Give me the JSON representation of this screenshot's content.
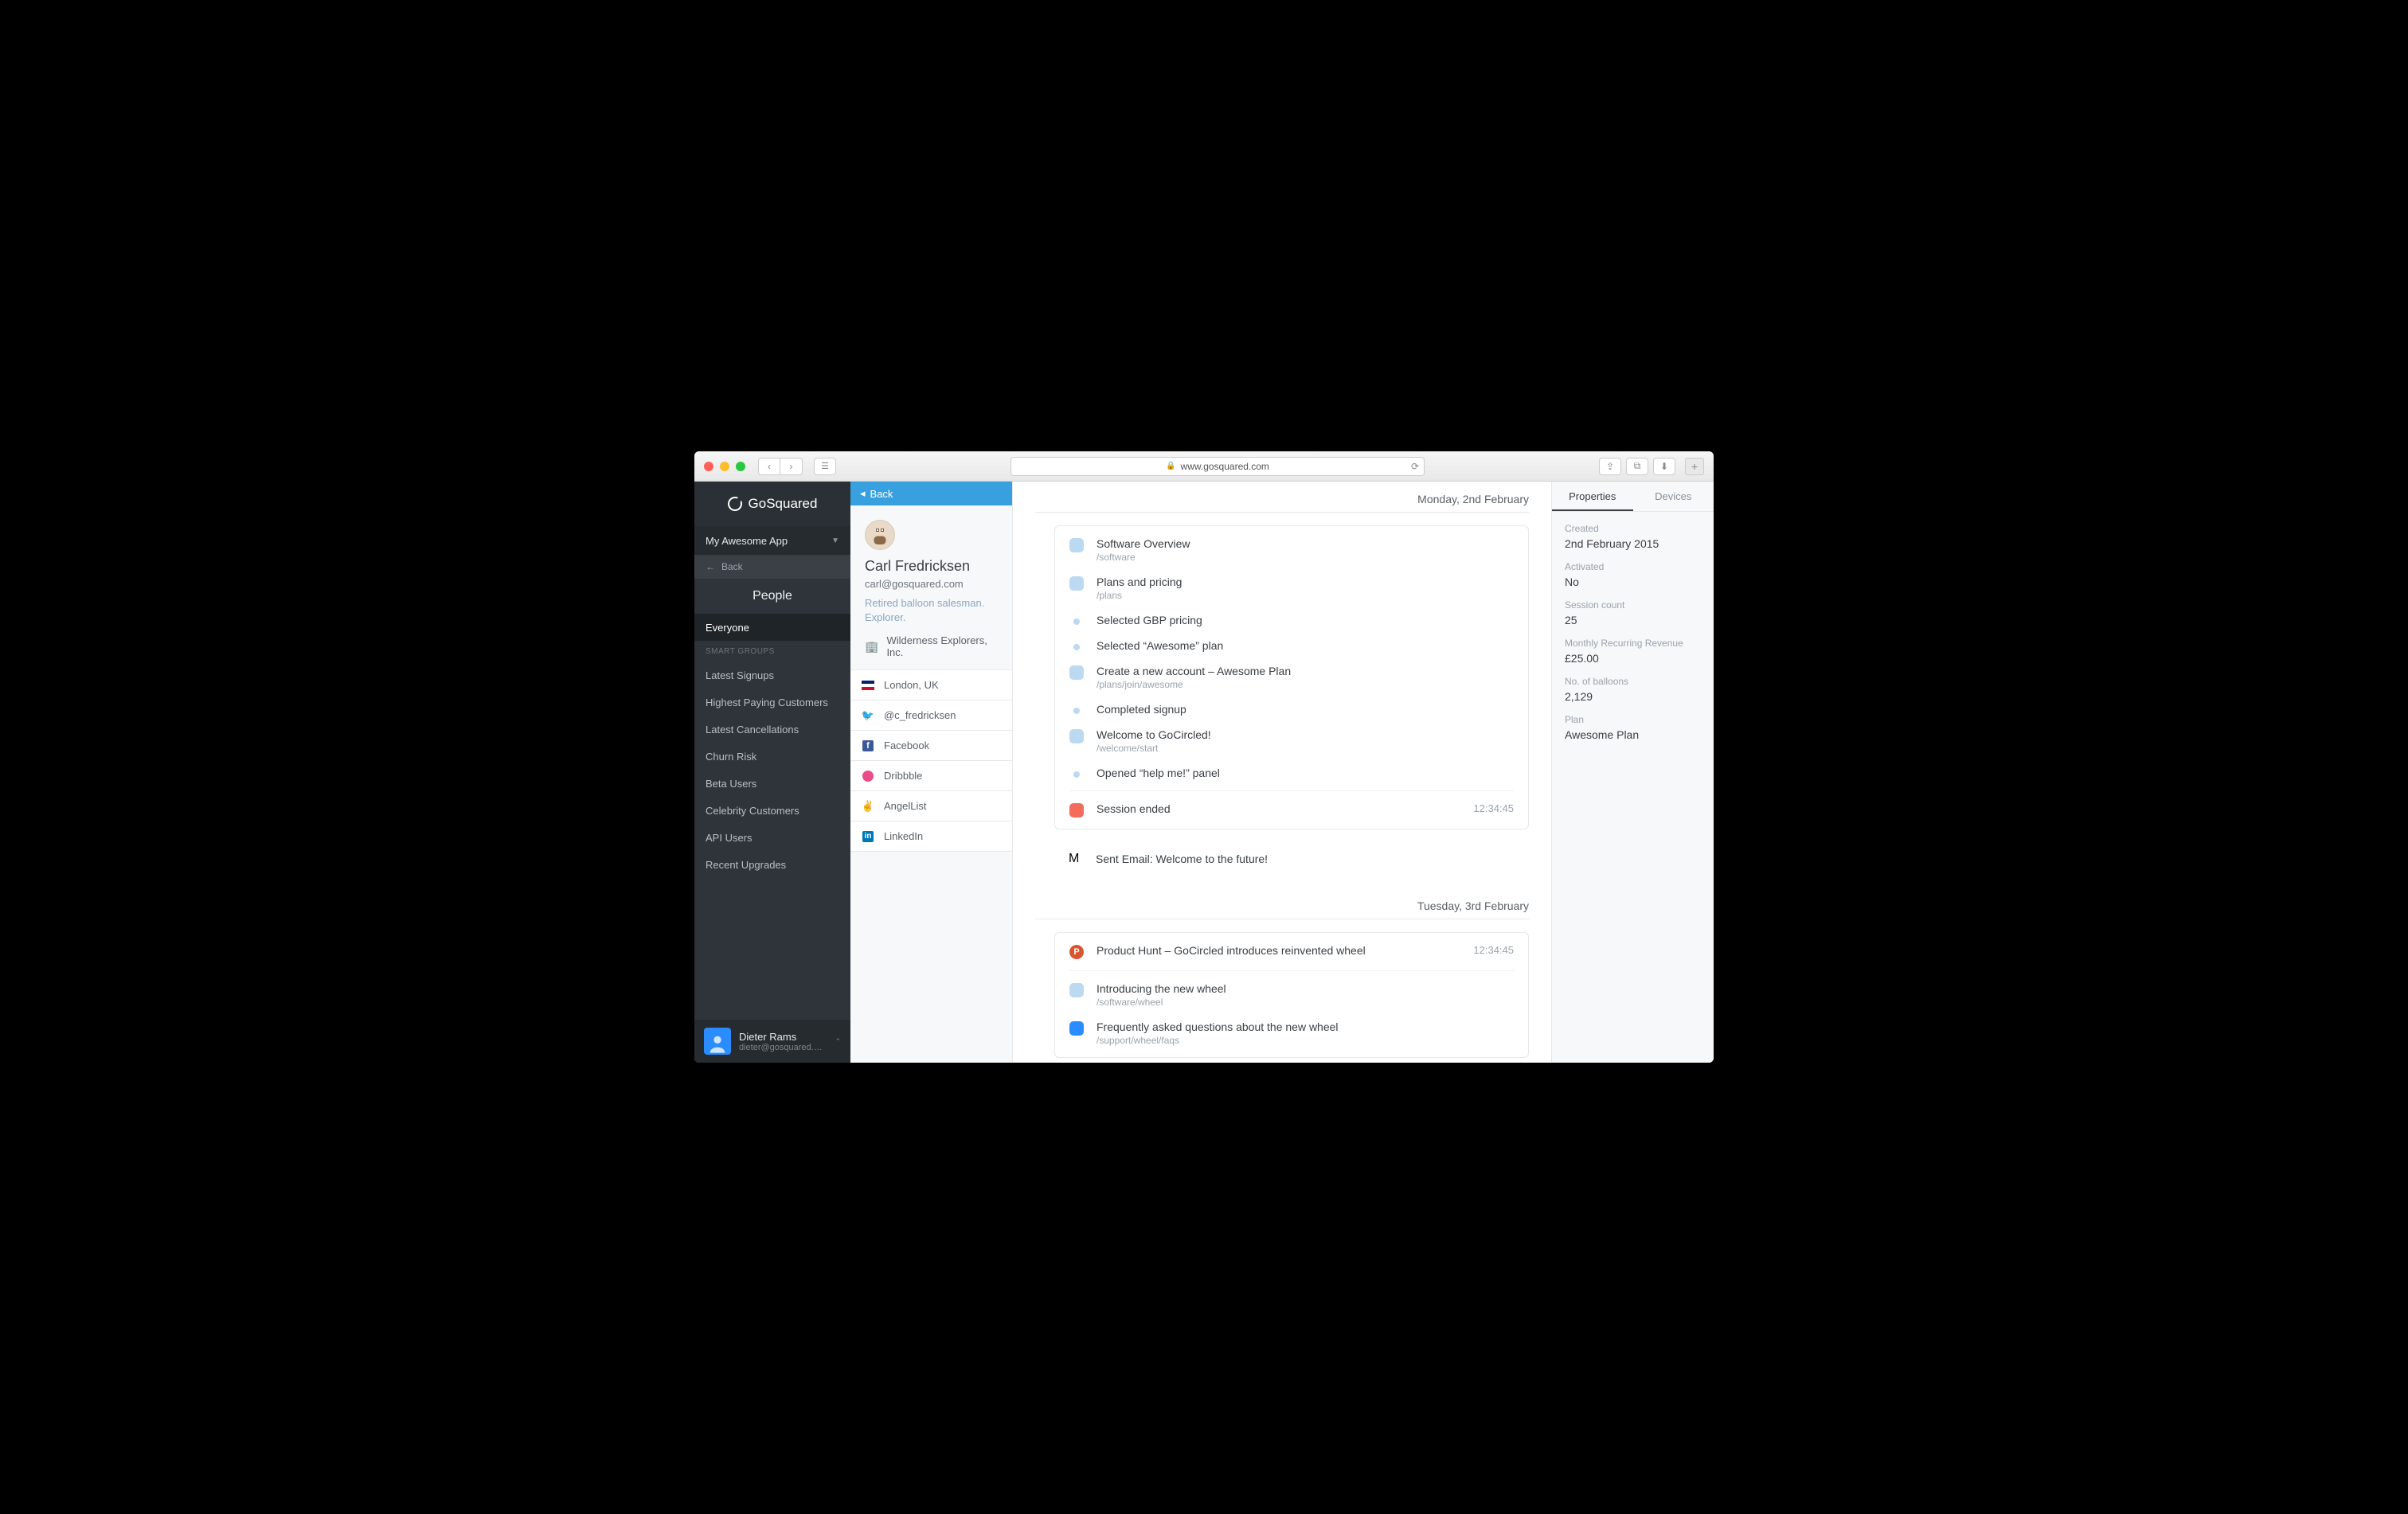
{
  "browser": {
    "url_display": "www.gosquared.com"
  },
  "sidebar": {
    "brand": "GoSquared",
    "app_name": "My Awesome App",
    "back": "Back",
    "section": "People",
    "active": "Everyone",
    "groups_header": "SMART GROUPS",
    "groups": [
      "Latest Signups",
      "Highest Paying Customers",
      "Latest Cancellations",
      "Churn Risk",
      "Beta Users",
      "Celebrity Customers",
      "API Users",
      "Recent Upgrades"
    ],
    "footer_user": {
      "name": "Dieter Rams",
      "email": "dieter@gosquared.…"
    }
  },
  "profile": {
    "back": "Back",
    "name": "Carl Fredricksen",
    "email": "carl@gosquared.com",
    "bio": "Retired balloon salesman. Explorer.",
    "company": "Wilderness Explorers, Inc.",
    "links": {
      "location": "London, UK",
      "twitter": "@c_fredricksen",
      "facebook": "Facebook",
      "dribbble": "Dribbble",
      "angellist": "AngelList",
      "linkedin": "LinkedIn"
    }
  },
  "timeline": {
    "day1": {
      "date": "Monday, 2nd  February",
      "events": [
        {
          "type": "page",
          "title": "Software Overview",
          "sub": "/software"
        },
        {
          "type": "page",
          "title": "Plans and pricing",
          "sub": "/plans"
        },
        {
          "type": "dot",
          "title": "Selected GBP pricing"
        },
        {
          "type": "dot",
          "title": "Selected “Awesome” plan"
        },
        {
          "type": "page",
          "title": "Create a new account – Awesome Plan",
          "sub": "/plans/join/awesome"
        },
        {
          "type": "dot",
          "title": "Completed signup"
        },
        {
          "type": "page",
          "title": "Welcome to GoCircled!",
          "sub": "/welcome/start"
        },
        {
          "type": "dot",
          "title": "Opened “help me!” panel"
        }
      ],
      "session_end": {
        "title": "Session ended",
        "time": "12:34:45"
      },
      "email": {
        "title": "Sent Email: Welcome to the future!"
      }
    },
    "day2": {
      "date": "Tuesday, 3rd  February",
      "ph": {
        "title": "Product Hunt – GoCircled introduces reinvented wheel",
        "time": "12:34:45"
      },
      "events": [
        {
          "type": "page",
          "title": "Introducing the new wheel",
          "sub": "/software/wheel"
        },
        {
          "type": "blue",
          "title": "Frequently asked questions about the new wheel",
          "sub": "/support/wheel/faqs"
        }
      ]
    }
  },
  "props": {
    "tabs": {
      "properties": "Properties",
      "devices": "Devices"
    },
    "items": [
      {
        "label": "Created",
        "value": "2nd February 2015"
      },
      {
        "label": "Activated",
        "value": "No"
      },
      {
        "label": "Session count",
        "value": "25"
      },
      {
        "label": "Monthly Recurring Revenue",
        "value": "£25.00"
      },
      {
        "label": "No. of balloons",
        "value": "2,129"
      },
      {
        "label": "Plan",
        "value": "Awesome Plan"
      }
    ]
  }
}
